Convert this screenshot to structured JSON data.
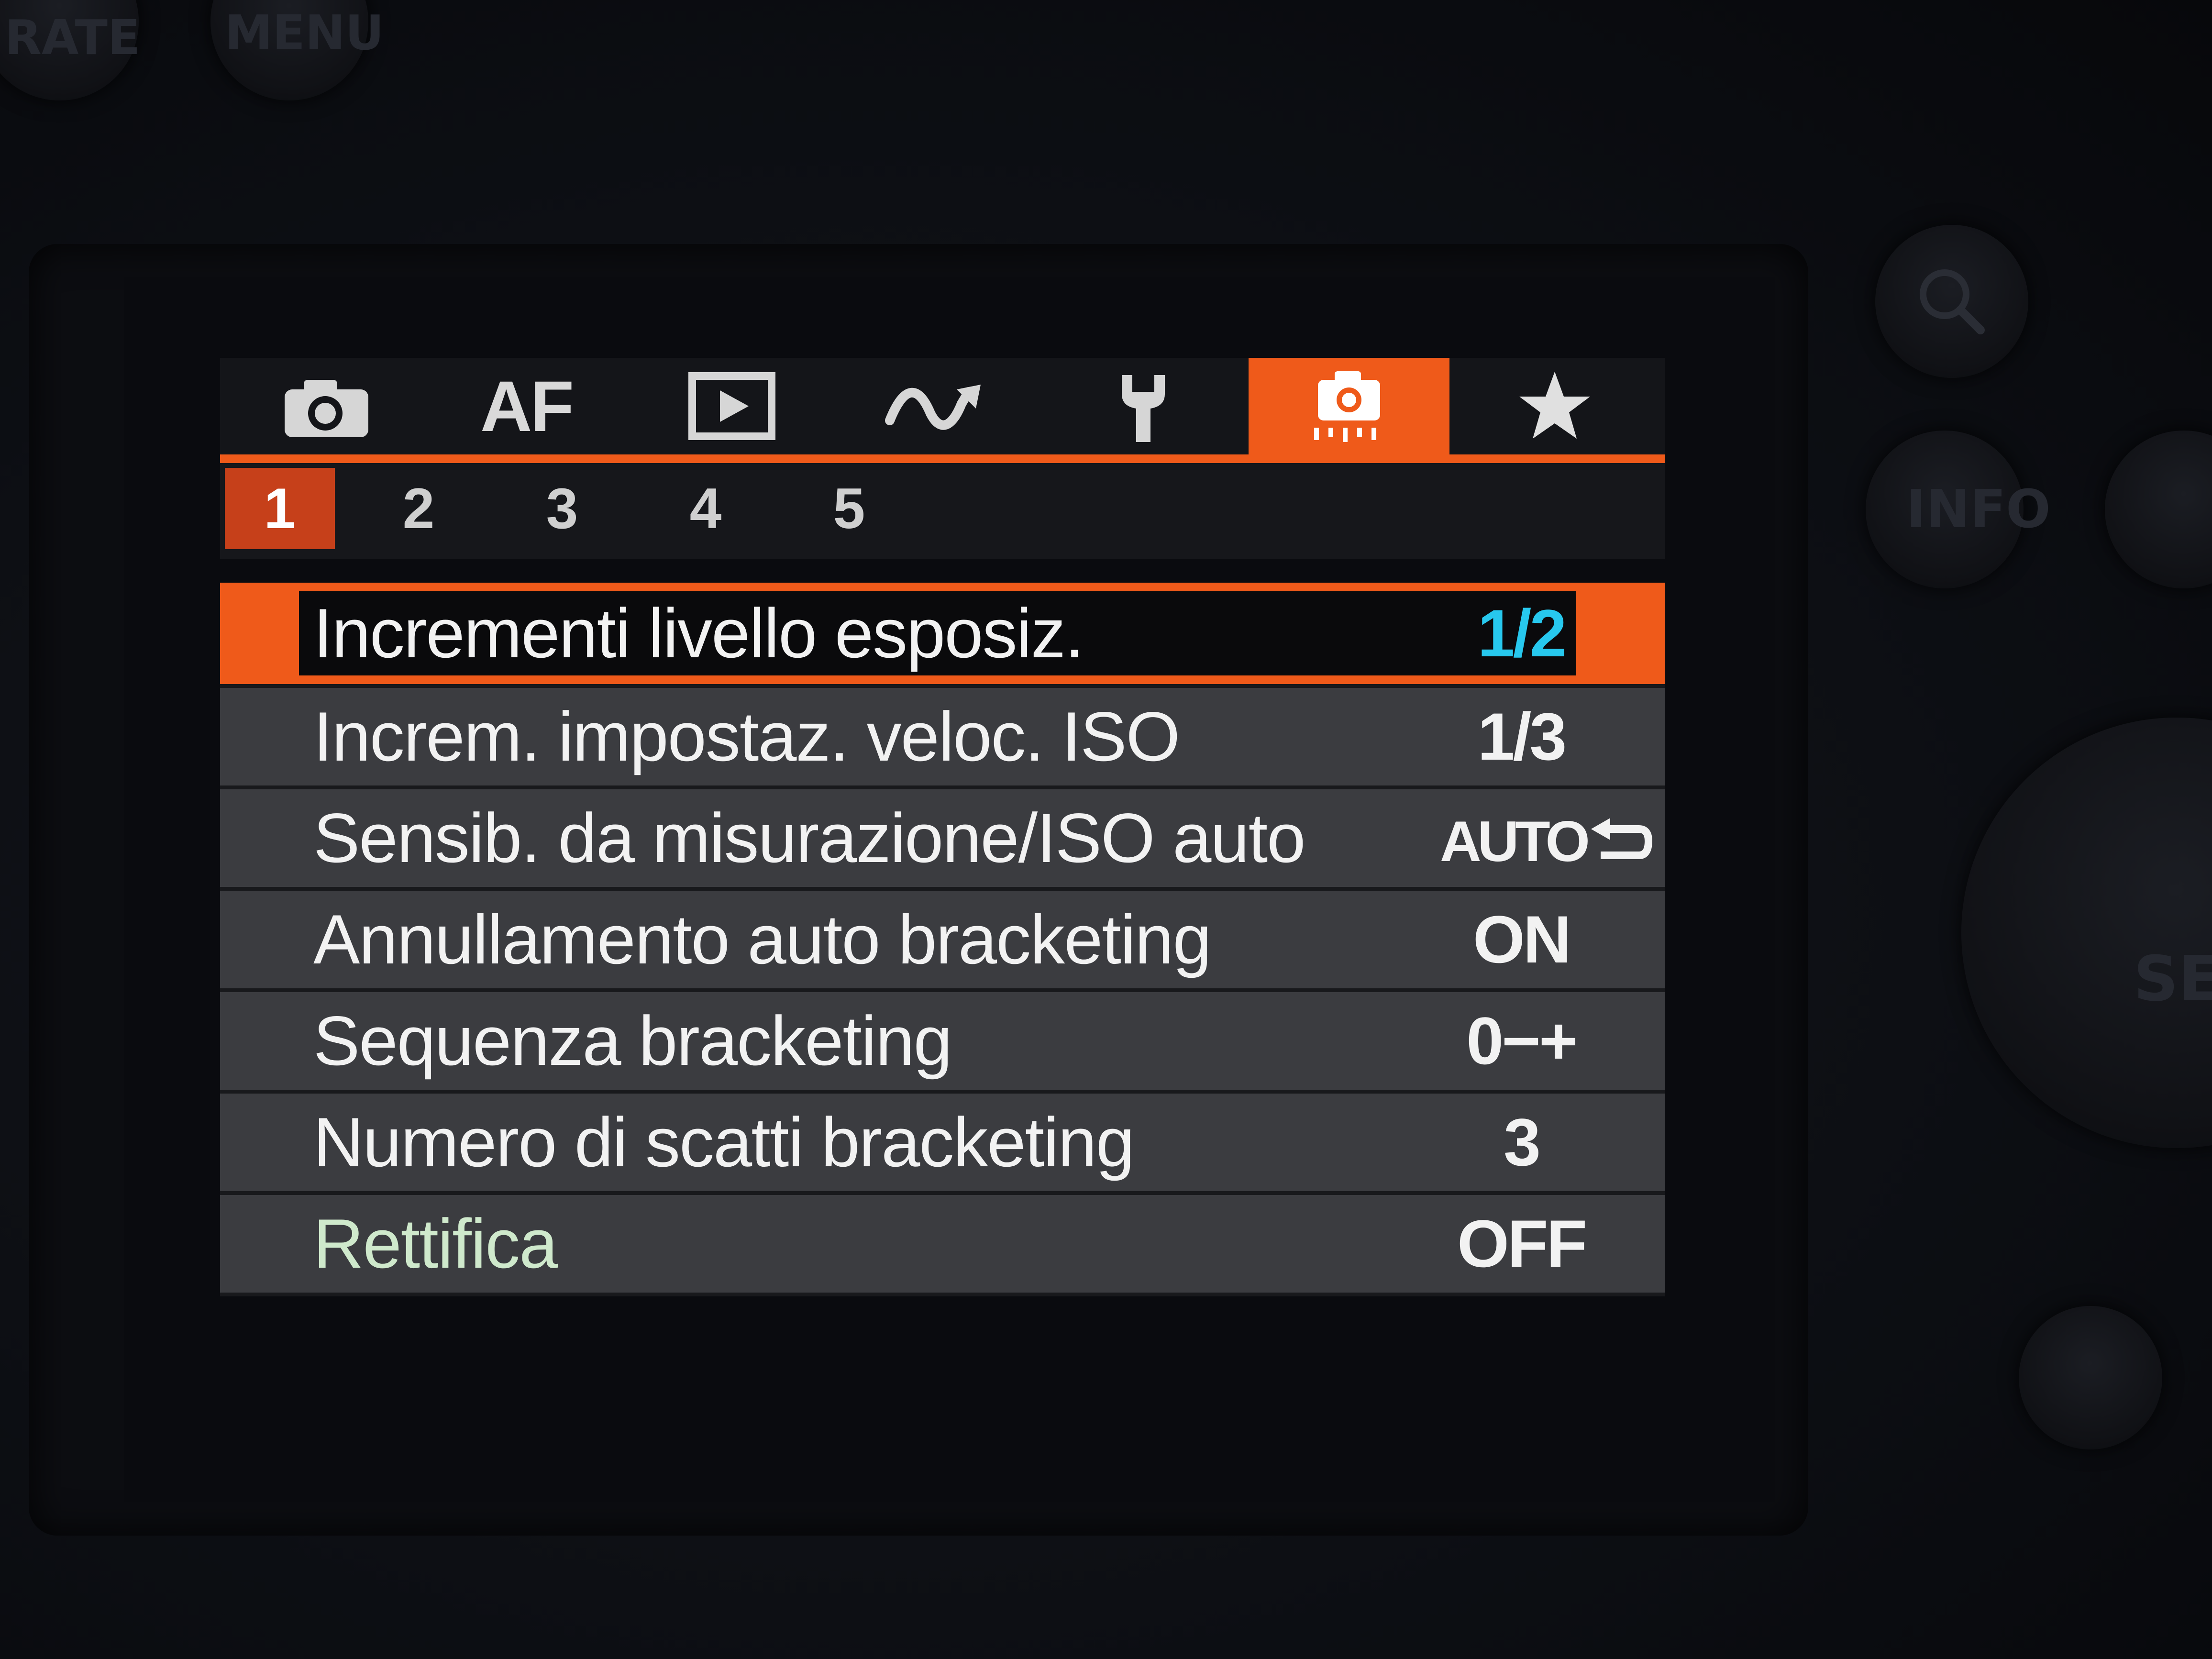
{
  "hardware": {
    "rate_label": "RATE",
    "menu_label": "MENU",
    "info_label": "INFO",
    "set_label": "SET"
  },
  "tabs": [
    {
      "name": "shooting",
      "icon": "camera-icon",
      "label": ""
    },
    {
      "name": "af",
      "icon": "",
      "label": "AF"
    },
    {
      "name": "playback",
      "icon": "play-icon",
      "label": ""
    },
    {
      "name": "wireless",
      "icon": "wave-icon",
      "label": ""
    },
    {
      "name": "setup",
      "icon": "wrench-icon",
      "label": ""
    },
    {
      "name": "custom-functions",
      "icon": "camera-custom-icon",
      "label": "",
      "active": true
    },
    {
      "name": "my-menu",
      "icon": "star-icon",
      "label": ""
    }
  ],
  "subtabs": [
    "1",
    "2",
    "3",
    "4",
    "5"
  ],
  "active_subtab": "1",
  "items": [
    {
      "label": "Incrementi livello esposiz.",
      "value": "1/2",
      "selected": true
    },
    {
      "label": "Increm. impostaz. veloc. ISO",
      "value": "1/3"
    },
    {
      "label": "Sensib. da misurazione/ISO auto",
      "value": "AUTO"
    },
    {
      "label": "Annullamento auto bracketing",
      "value": "ON"
    },
    {
      "label": "Sequenza bracketing",
      "value": "0−+"
    },
    {
      "label": "Numero di scatti bracketing",
      "value": "3"
    },
    {
      "label": "Rettifica",
      "value": "OFF"
    }
  ],
  "colors": {
    "accent": "#ef5a1a",
    "selected_value": "#27c8ee",
    "row_bg": "#3b3c40",
    "rettifica_label": "#cfe9cc"
  }
}
